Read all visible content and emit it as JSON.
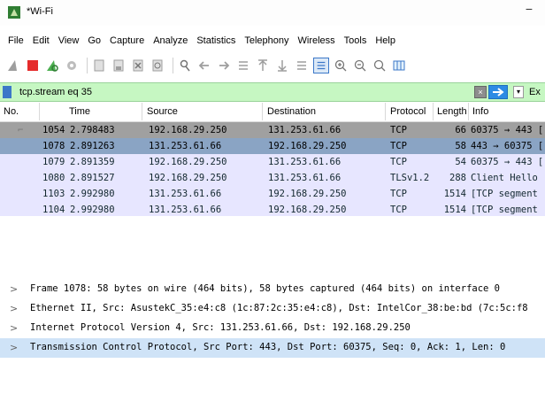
{
  "window": {
    "title": "*Wi-Fi",
    "minimize_glyph": "−"
  },
  "menu": [
    "File",
    "Edit",
    "View",
    "Go",
    "Capture",
    "Analyze",
    "Statistics",
    "Telephony",
    "Wireless",
    "Tools",
    "Help"
  ],
  "toolbar": {
    "icons": [
      "shark-fin-start-icon",
      "stop-icon",
      "restart-icon",
      "options-icon",
      "open-icon",
      "save-icon",
      "close-file-icon",
      "reload-icon",
      "find-icon",
      "back-icon",
      "forward-icon",
      "goto-icon",
      "first-icon",
      "last-icon",
      "autoscroll-icon",
      "colorize-icon",
      "zoom-in-icon",
      "zoom-out-icon",
      "zoom-normal-icon",
      "resize-columns-icon"
    ]
  },
  "filter": {
    "value": "tcp.stream eq 35",
    "clear_glyph": "×",
    "dropdown_glyph": "▾",
    "expression_label": "Ex"
  },
  "columns": {
    "no": "No.",
    "time": "Time",
    "source": "Source",
    "destination": "Destination",
    "protocol": "Protocol",
    "length": "Length",
    "info": "Info"
  },
  "packets": [
    {
      "no": "1054",
      "time": "2.798483",
      "source": "192.168.29.250",
      "destination": "131.253.61.66",
      "protocol": "TCP",
      "length": "66",
      "info": "60375 → 443 [",
      "bg": "#a0a0a0",
      "fg": "#000000"
    },
    {
      "no": "1078",
      "time": "2.891263",
      "source": "131.253.61.66",
      "destination": "192.168.29.250",
      "protocol": "TCP",
      "length": "58",
      "info": "443 → 60375 [",
      "bg": "#8aa4c4",
      "fg": "#000000"
    },
    {
      "no": "1079",
      "time": "2.891359",
      "source": "192.168.29.250",
      "destination": "131.253.61.66",
      "protocol": "TCP",
      "length": "54",
      "info": "60375 → 443 [",
      "bg": "#e7e6ff",
      "fg": "#12272e"
    },
    {
      "no": "1080",
      "time": "2.891527",
      "source": "192.168.29.250",
      "destination": "131.253.61.66",
      "protocol": "TLSv1.2",
      "length": "288",
      "info": "Client Hello",
      "bg": "#e7e6ff",
      "fg": "#12272e"
    },
    {
      "no": "1103",
      "time": "2.992980",
      "source": "131.253.61.66",
      "destination": "192.168.29.250",
      "protocol": "TCP",
      "length": "1514",
      "info": "[TCP segment",
      "bg": "#e7e6ff",
      "fg": "#12272e"
    },
    {
      "no": "1104",
      "time": "2.992980",
      "source": "131.253.61.66",
      "destination": "192.168.29.250",
      "protocol": "TCP",
      "length": "1514",
      "info": "[TCP segment",
      "bg": "#e7e6ff",
      "fg": "#12272e"
    }
  ],
  "details": [
    {
      "arrow": ">",
      "text": "Frame 1078: 58 bytes on wire (464 bits), 58 bytes captured (464 bits) on interface 0",
      "selected": false
    },
    {
      "arrow": ">",
      "text": "Ethernet II, Src: AsustekC_35:e4:c8 (1c:87:2c:35:e4:c8), Dst: IntelCor_38:be:bd (7c:5c:f8",
      "selected": false
    },
    {
      "arrow": ">",
      "text": "Internet Protocol Version 4, Src: 131.253.61.66, Dst: 192.168.29.250",
      "selected": false
    },
    {
      "arrow": ">",
      "text": "Transmission Control Protocol, Src Port: 443, Dst Port: 60375, Seq: 0, Ack: 1, Len: 0",
      "selected": true
    }
  ],
  "colors": {
    "filter_bg": "#c6f7c2",
    "selected_detail_bg": "#cfe3f7",
    "accent_blue": "#2d8be4"
  }
}
